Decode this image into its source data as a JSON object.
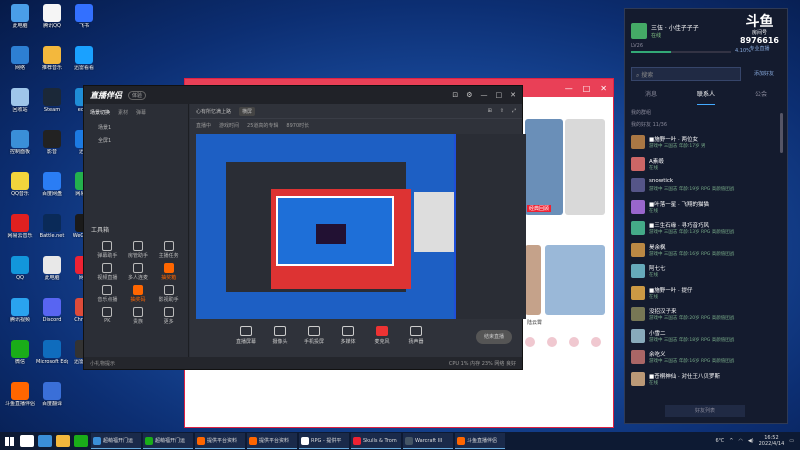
{
  "desktop": {
    "icons": [
      {
        "label": "此电脑",
        "color": "#4a9ee8"
      },
      {
        "label": "腾讯QQ",
        "color": "#f5f5f5"
      },
      {
        "label": "飞书",
        "color": "#3370ff"
      },
      {
        "label": "网络",
        "color": "#2d7fd3"
      },
      {
        "label": "推荐音乐",
        "color": "#f3b83d"
      },
      {
        "label": "迅雷看看",
        "color": "#1aa1ff"
      },
      {
        "label": "回收站",
        "color": "#9fc6ea"
      },
      {
        "label": "Steam",
        "color": "#1b2838"
      },
      {
        "label": "edge",
        "color": "#1f8dd6"
      },
      {
        "label": "控制面板",
        "color": "#3a8fd8"
      },
      {
        "label": "影音",
        "color": "#222"
      },
      {
        "label": "迅雷",
        "color": "#1c7ae2"
      },
      {
        "label": "QQ音乐",
        "color": "#f2d53c"
      },
      {
        "label": "百度网盘",
        "color": "#2a7df5"
      },
      {
        "label": "网易UU",
        "color": "#23b14d"
      },
      {
        "label": "网易云音乐",
        "color": "#e02020"
      },
      {
        "label": "Battle.net",
        "color": "#0a2a58"
      },
      {
        "label": "WeGame",
        "color": "#1a1a1a"
      },
      {
        "label": "QQ",
        "color": "#1296db"
      },
      {
        "label": "此电脑",
        "color": "#e8e8e8"
      },
      {
        "label": "网易",
        "color": "#e23"
      },
      {
        "label": "腾讯视频",
        "color": "#2aa3ef"
      },
      {
        "label": "Discord",
        "color": "#5865f2"
      },
      {
        "label": "Chrome",
        "color": "#dd4b39"
      },
      {
        "label": "微信",
        "color": "#1aad19"
      },
      {
        "label": "Microsoft Edge",
        "color": "#0f6cbd"
      },
      {
        "label": "迅雷影音",
        "color": "#333"
      },
      {
        "label": "斗鱼直播伴侣",
        "color": "#f60"
      },
      {
        "label": "百度翻译",
        "color": "#3a6fd8"
      }
    ]
  },
  "browser": {
    "controls": [
      "—",
      "□",
      "✕"
    ],
    "thumb_label_1": "经典回顾",
    "thumb_label_2": "陆云霄",
    "thumb_label_3": "2",
    "sidebar_icons": 4
  },
  "obs": {
    "app_name": "直播伴侣",
    "badge": "体验",
    "window_controls": [
      "⊡",
      "⚙",
      "—",
      "□",
      "✕"
    ],
    "left_tabs": [
      {
        "label": "场景切换",
        "active": true
      },
      {
        "label": "素材",
        "active": false
      },
      {
        "label": "弹幕",
        "active": false
      }
    ],
    "scenes": [
      "场景1",
      "全屏1"
    ],
    "tool_title": "工具箱",
    "tools": [
      {
        "label": "弹幕助手",
        "highlight": false
      },
      {
        "label": "房管助手",
        "highlight": false
      },
      {
        "label": "主播任务",
        "highlight": false
      },
      {
        "label": "视频直播",
        "highlight": false
      },
      {
        "label": "多人连麦",
        "highlight": false
      },
      {
        "label": "抽奖箱",
        "highlight": true
      },
      {
        "label": "音乐点播",
        "highlight": false
      },
      {
        "label": "抽奖码",
        "highlight": true
      },
      {
        "label": "影视助手",
        "highlight": false
      },
      {
        "label": "PK",
        "highlight": false
      },
      {
        "label": "贵族",
        "highlight": false
      },
      {
        "label": "更多",
        "highlight": false
      }
    ],
    "header_title": "心有所忆满上路",
    "header_chip": "横屏",
    "sub_items": [
      "直播中",
      "游戏时间",
      "25道高的专辑",
      "8970时长"
    ],
    "bottom_tools": [
      {
        "label": "直播屏幕",
        "red": false
      },
      {
        "label": "摄像头",
        "red": false
      },
      {
        "label": "手机投屏",
        "red": false
      },
      {
        "label": "多媒体",
        "red": false
      },
      {
        "label": "麦克风",
        "red": true
      },
      {
        "label": "扬声器",
        "red": false
      }
    ],
    "stop_label": "结束直播",
    "status_left": "小礼物提示",
    "status_right": "CPU  1%  内存  23%  网络  良好"
  },
  "chat": {
    "username": "三伍 · 小佳子子子",
    "status": "在线",
    "brand": "斗鱼",
    "brand_sub": "房间号",
    "room_id": "8976616",
    "room_sub": "专业直播",
    "level_left": "LV26",
    "level_pct": "4.10%",
    "level_fraction": 0.4,
    "search_placeholder": "搜索",
    "add_friend": "添加好友",
    "tabs": [
      {
        "label": "消息",
        "active": false
      },
      {
        "label": "联系人",
        "active": true
      },
      {
        "label": "公会",
        "active": false
      }
    ],
    "group_1": "我的群组",
    "group_2": "我的好友  11/36",
    "friends": [
      {
        "name": "■施野一叶 · 两位女",
        "status": "游戏中 三国志 年龄:17岁 男 ",
        "color": "#a74"
      },
      {
        "name": "A素缎",
        "status": "在线",
        "color": "#c66"
      },
      {
        "name": "snowtick",
        "status": "游戏中 三国志 年龄:19岁 RPG 高颜值团战",
        "color": "#558"
      },
      {
        "name": "■叶落一星 · 飞翔的猫猫",
        "status": "在线",
        "color": "#96c"
      },
      {
        "name": "■三生石缘 · 寻巧音巧风",
        "status": "游戏中 三国志 年龄:13岁 RPG 高颜值团战",
        "color": "#4a8"
      },
      {
        "name": "昊余枫",
        "status": "游戏中 三国志 年龄:16岁 RPG 高颜值团战",
        "color": "#b84"
      },
      {
        "name": "阿七七",
        "status": "在线",
        "color": "#6ab"
      },
      {
        "name": "■施野一叶 · 提仔",
        "status": "在线",
        "color": "#c94"
      },
      {
        "name": "没招汉子来",
        "status": "游戏中 三国志 年龄:20岁 RPG 高颜值团战",
        "color": "#775"
      },
      {
        "name": "小雪二",
        "status": "游戏中 三国志 年龄:18岁 RPG 高颜值团战",
        "color": "#8ab"
      },
      {
        "name": "余吃义",
        "status": "游戏中 三国志 年龄:16岁 RPG 高颜值团战",
        "color": "#a66"
      },
      {
        "name": "■苍桐神仙 · 对仕王八贝罗斯",
        "status": "在线",
        "color": "#b97"
      }
    ],
    "footer": "好友列表"
  },
  "taskbar": {
    "pinned": [
      {
        "color": "#fff"
      },
      {
        "color": "#3a8fd8"
      },
      {
        "color": "#f3b83d"
      },
      {
        "color": "#1aad19"
      }
    ],
    "items": [
      {
        "label": "超萌福开门运",
        "color": "#3a8fd8"
      },
      {
        "label": "超萌福开门运",
        "color": "#1aad19"
      },
      {
        "label": "提供平台资料",
        "color": "#f60"
      },
      {
        "label": "提供平台资料",
        "color": "#f60"
      },
      {
        "label": "RPG - 提供平",
        "color": "#fff"
      },
      {
        "label": "Skulls & Trom",
        "color": "#e23"
      },
      {
        "label": "Warcraft III",
        "color": "#456"
      },
      {
        "label": "斗鱼直播伴侣",
        "color": "#f60"
      }
    ],
    "weather": "6℃",
    "time": "16:52",
    "date": "2022/4/14"
  }
}
